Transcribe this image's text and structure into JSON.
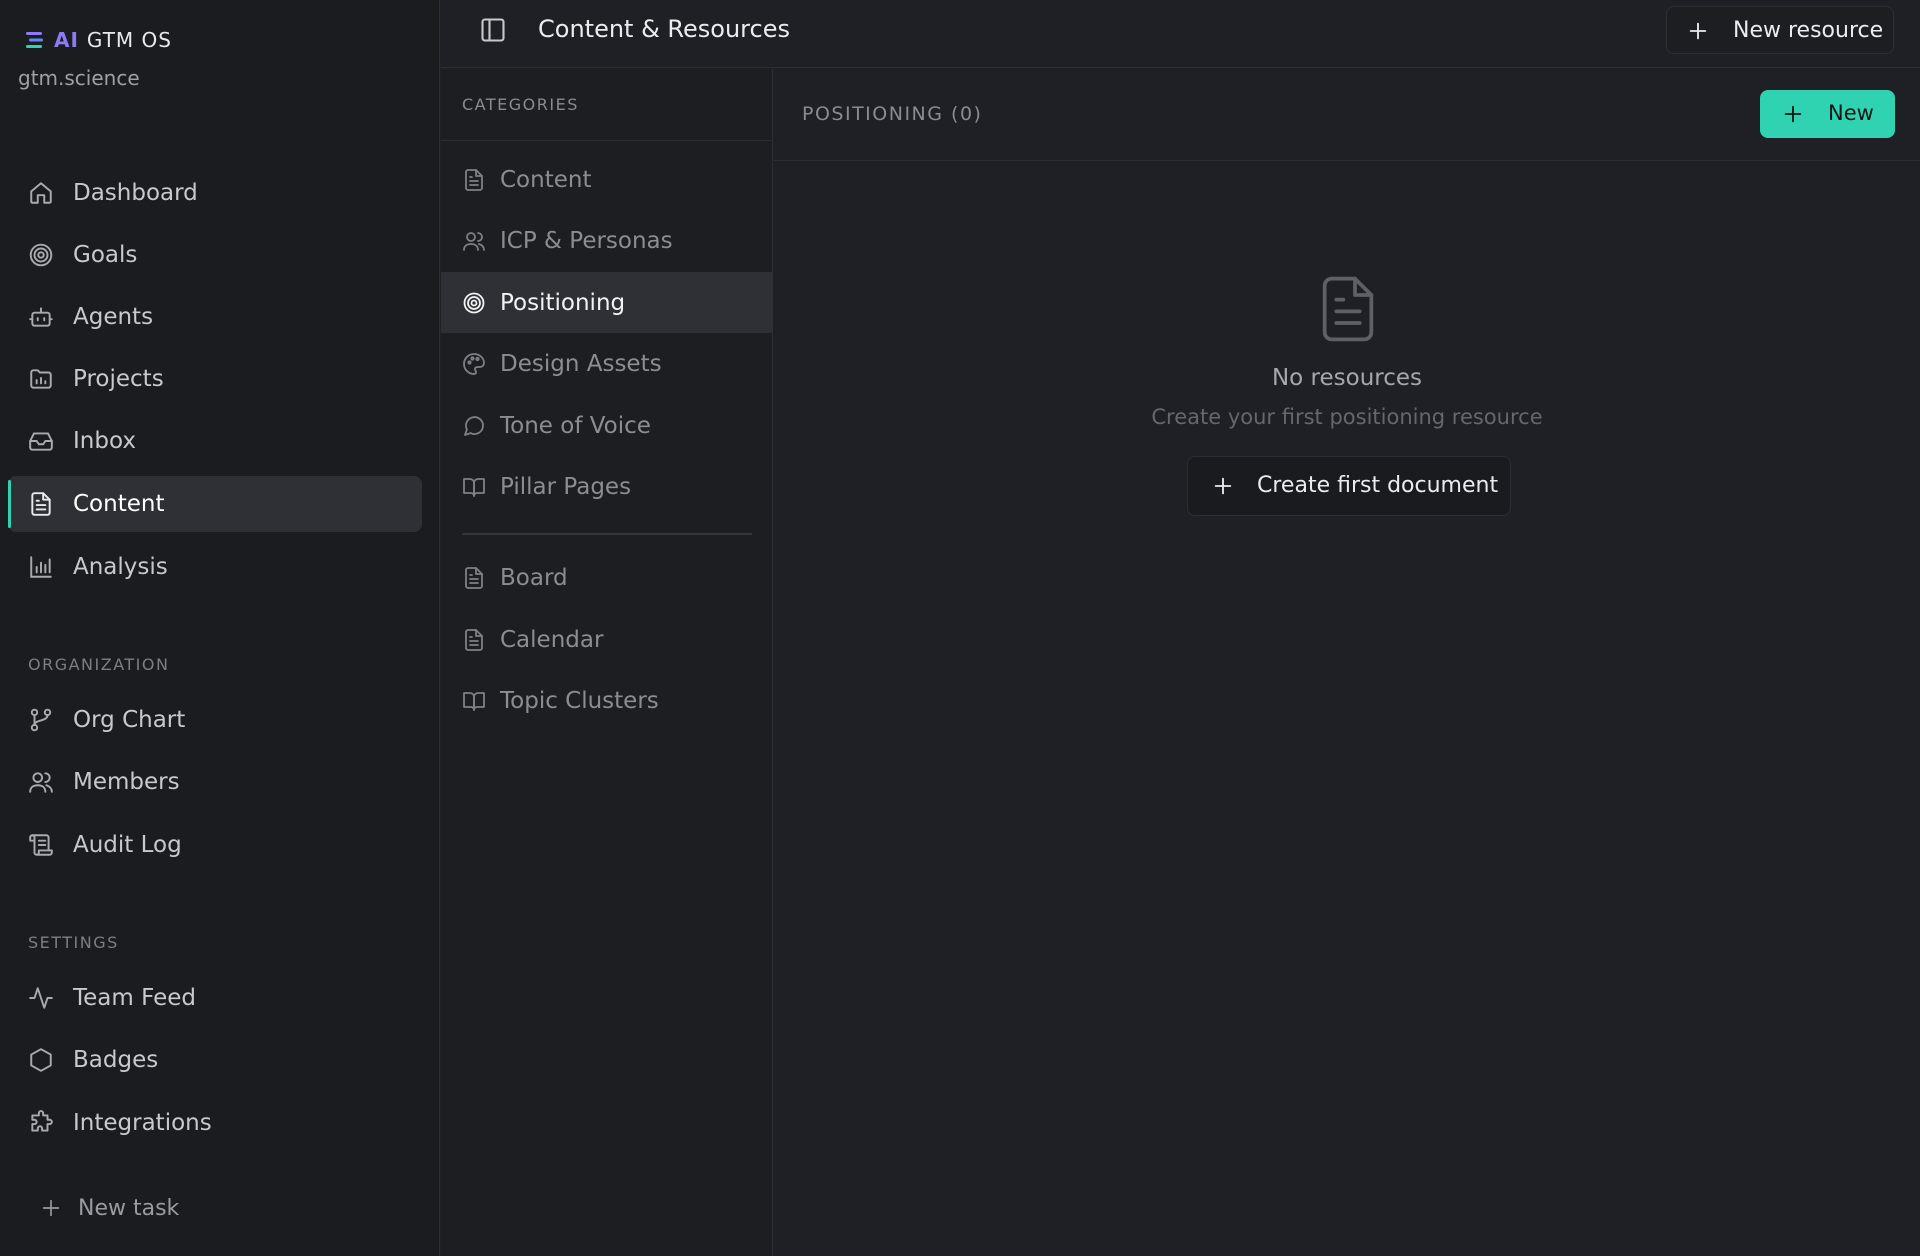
{
  "brand": {
    "ai": "AI",
    "name": "GTM OS",
    "org": "gtm.science",
    "accent": "#8b7cf6"
  },
  "nav": {
    "items": [
      {
        "label": "Dashboard",
        "icon": "home-icon"
      },
      {
        "label": "Goals",
        "icon": "target-icon"
      },
      {
        "label": "Agents",
        "icon": "bot-icon"
      },
      {
        "label": "Projects",
        "icon": "folder-chart-icon"
      },
      {
        "label": "Inbox",
        "icon": "inbox-icon"
      },
      {
        "label": "Content",
        "icon": "file-text-icon",
        "active": true
      },
      {
        "label": "Analysis",
        "icon": "bar-chart-icon"
      }
    ],
    "organization_label": "ORGANIZATION",
    "organization": [
      {
        "label": "Org Chart",
        "icon": "git-branch-icon"
      },
      {
        "label": "Members",
        "icon": "users-icon"
      },
      {
        "label": "Audit Log",
        "icon": "scroll-icon"
      }
    ],
    "settings_label": "SETTINGS",
    "settings": [
      {
        "label": "Team Feed",
        "icon": "activity-icon"
      },
      {
        "label": "Badges",
        "icon": "hexagon-icon"
      },
      {
        "label": "Integrations",
        "icon": "puzzle-icon"
      }
    ],
    "new_task": "New task"
  },
  "topbar": {
    "title": "Content & Resources",
    "new_resource": "New resource"
  },
  "categories": {
    "heading": "CATEGORIES",
    "items": [
      {
        "label": "Content",
        "icon": "file-text-icon"
      },
      {
        "label": "ICP & Personas",
        "icon": "users-icon"
      },
      {
        "label": "Positioning",
        "icon": "target-icon",
        "active": true
      },
      {
        "label": "Design Assets",
        "icon": "palette-icon"
      },
      {
        "label": "Tone of Voice",
        "icon": "message-circle-icon"
      },
      {
        "label": "Pillar Pages",
        "icon": "book-open-icon"
      }
    ],
    "extra": [
      {
        "label": "Board",
        "icon": "file-text-icon"
      },
      {
        "label": "Calendar",
        "icon": "file-text-icon"
      },
      {
        "label": "Topic Clusters",
        "icon": "book-open-icon"
      }
    ]
  },
  "main": {
    "title": "POSITIONING (0)",
    "new_label": "New",
    "empty": {
      "title": "No resources",
      "subtitle": "Create your first positioning resource",
      "action": "Create first document"
    }
  },
  "colors": {
    "accent": "#2fd3b2",
    "background": "#1f2025",
    "sidebar": "#1b1c20"
  }
}
